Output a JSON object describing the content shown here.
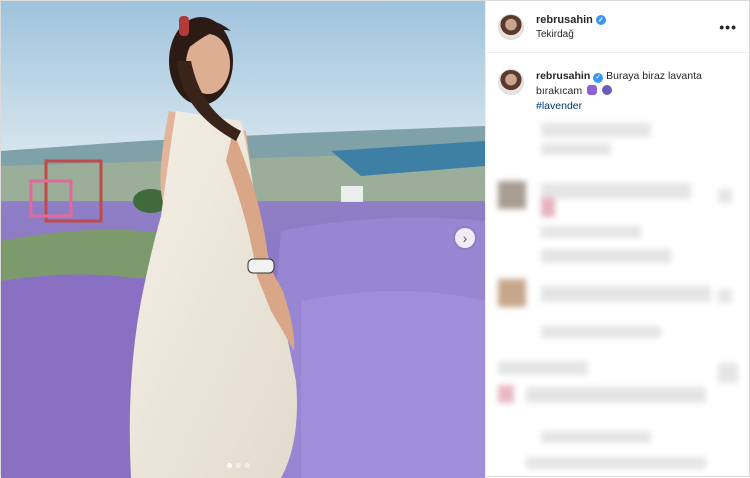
{
  "post": {
    "username": "rebrusahin",
    "location": "Tekirdağ",
    "more_label": "•••",
    "verified_mark": "✓",
    "caption": {
      "username": "rebrusahin",
      "text": "Buraya biraz lavanta bırakıcam",
      "hashtag": "#lavender",
      "emojis": [
        "purple-heart-emoji",
        "grapes-emoji"
      ]
    },
    "carousel": {
      "next_icon": "›",
      "slides": 3,
      "current": 1
    }
  },
  "colors": {
    "link": "#00376b",
    "verified": "#3897f0",
    "lavender": "#8d74c9",
    "sky": "#c2d9e6"
  }
}
